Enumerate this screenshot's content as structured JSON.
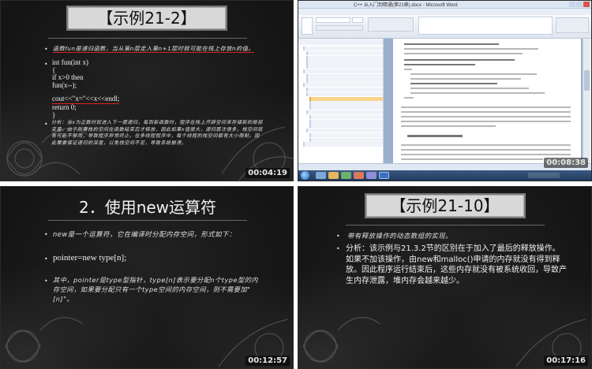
{
  "tiles": [
    {
      "title": "【示例21-2】",
      "timestamp": "00:04:19",
      "intro": "函数fun是递归函数，当从第n层走入第n+1层时就可能在栈上存放n的值。",
      "code": [
        "int fun(int x)",
        "{",
        "if x>0 then",
        "fun(x--);",
        "cout<<\"x=\"<<x<<endl;",
        "return 0;",
        "}"
      ],
      "analysis": "分析：当x为正数时就进入下一层递归，每到新函数时，程序在栈上开辟空间来存储新的局部变量。由于所需栈的空间在函数结束后才释放，因此如果x值很大，递归层次很多，栈空间就有可能不够用，导致程序异常终止。在多线程程序中，每个线程的栈空间都有大小限制，因此需要保证递归的深度，以免栈空间不足，导致系统崩溃。"
    },
    {
      "window_title": "C++ 从入门到精通(第21章).docx - Microsoft Word",
      "timestamp": "00:08:38"
    },
    {
      "title": "2．使用new运算符",
      "timestamp": "00:12:57",
      "p1": "new是一个运算符，它在编译时分配内存空间，形式如下：",
      "p2": "pointer=new type[n];",
      "p3": "其中，pointer是type型指针，type[n]表示要分配n个type型的内存空间，如果要分配只有一个type空间的内存空间，则不需要加\"[n]\"。"
    },
    {
      "title": "【示例21-10】",
      "timestamp": "00:17:16",
      "p1": "带有释放操作的动态数组的实现。",
      "p2": "分析：该示例与21.3.2节的区别在于加入了最后的释放操作。如果不加该操作，由new和malloc()申请的内存就没有得到释放。因此程序运行结束后，这些内存就没有被系统收回，导致产生内存泄露，堆内存会越来越少。"
    }
  ],
  "colors": {
    "slide_bg": "#151515",
    "title_box": "#d8d8d8",
    "underline": "#e02020"
  }
}
